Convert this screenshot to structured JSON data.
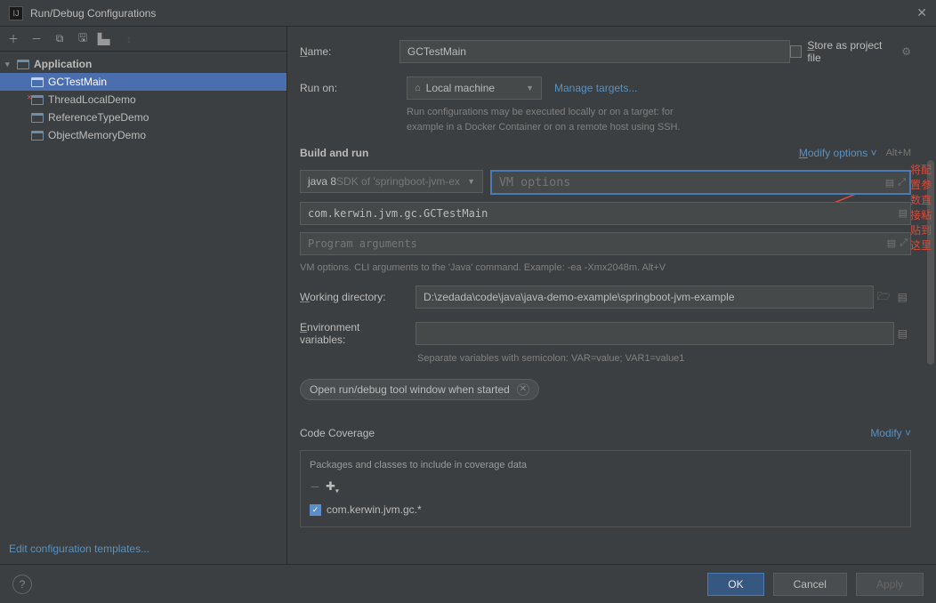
{
  "window": {
    "title": "Run/Debug Configurations"
  },
  "tree": {
    "root": "Application",
    "items": [
      "GCTestMain",
      "ThreadLocalDemo",
      "ReferenceTypeDemo",
      "ObjectMemoryDemo"
    ],
    "selected": 0
  },
  "sidebar": {
    "edit_templates": "Edit configuration templates..."
  },
  "form": {
    "name_label": "Name:",
    "name_value": "GCTestMain",
    "store_label": "Store as project file",
    "runon_label": "Run on:",
    "runon_value": "Local machine",
    "manage_targets": "Manage targets...",
    "runon_hint": "Run configurations may be executed locally or on a target: for\nexample in a Docker Container or on a remote host using SSH.",
    "build_section": "Build and run",
    "modify_options": "Modify options",
    "modify_shortcut": "Alt+M",
    "sdk_prefix": "java 8 ",
    "sdk_suffix": "SDK of 'springboot-jvm-ex",
    "vm_placeholder": "VM options",
    "main_class": "com.kerwin.jvm.gc.GCTestMain",
    "program_args_placeholder": "Program arguments",
    "vm_note": "VM options. CLI arguments to the 'Java' command. Example: -ea -Xmx2048m. Alt+V",
    "workdir_label": "Working directory:",
    "workdir_value": "D:\\zedada\\code\\java\\java-demo-example\\springboot-jvm-example",
    "env_label": "Environment variables:",
    "env_hint": "Separate variables with semicolon: VAR=value; VAR1=value1",
    "chip_label": "Open run/debug tool window when started",
    "coverage_section": "Code Coverage",
    "coverage_modify": "Modify",
    "coverage_label": "Packages and classes to include in coverage data",
    "coverage_item": "com.kerwin.jvm.gc.*"
  },
  "annotation": "将配置参数直接粘贴到这里",
  "buttons": {
    "ok": "OK",
    "cancel": "Cancel",
    "apply": "Apply"
  }
}
